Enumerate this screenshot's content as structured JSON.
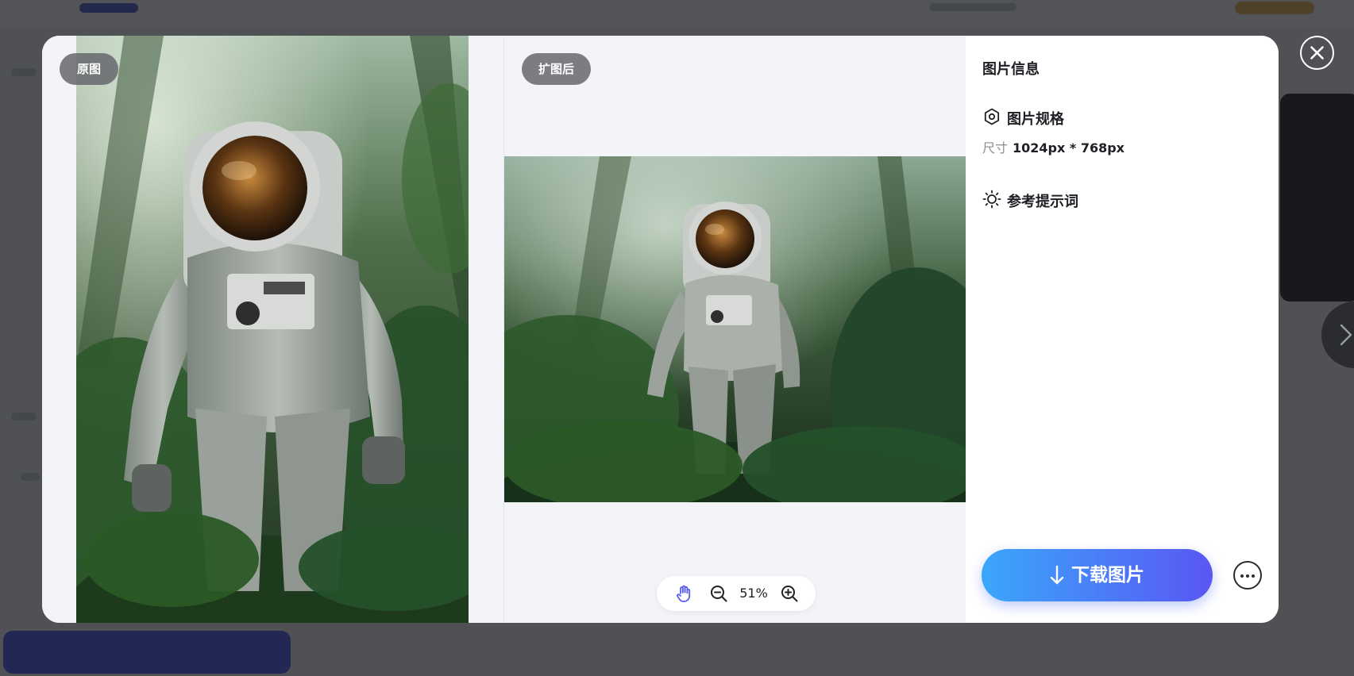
{
  "comparison": {
    "original_label": "原图",
    "expanded_label": "扩图后"
  },
  "zoom": {
    "value": "51%"
  },
  "info_panel": {
    "title": "图片信息",
    "spec_section": {
      "title": "图片规格",
      "size_label": "尺寸",
      "size_value": "1024px * 768px"
    },
    "prompt_section": {
      "title": "参考提示词"
    },
    "download_label": "下载图片"
  },
  "colors": {
    "download_gradient_start": "#3aa7fb",
    "download_gradient_end": "#5a56f4",
    "zoom_hand_active": "#5b5cf0",
    "badge_background": "#616369"
  },
  "icons": [
    "hand-icon",
    "zoom-out-icon",
    "zoom-in-icon",
    "hexagon-settings-icon",
    "sun-icon",
    "download-arrow-icon",
    "more-icon",
    "close-icon",
    "chevron-right-icon"
  ]
}
